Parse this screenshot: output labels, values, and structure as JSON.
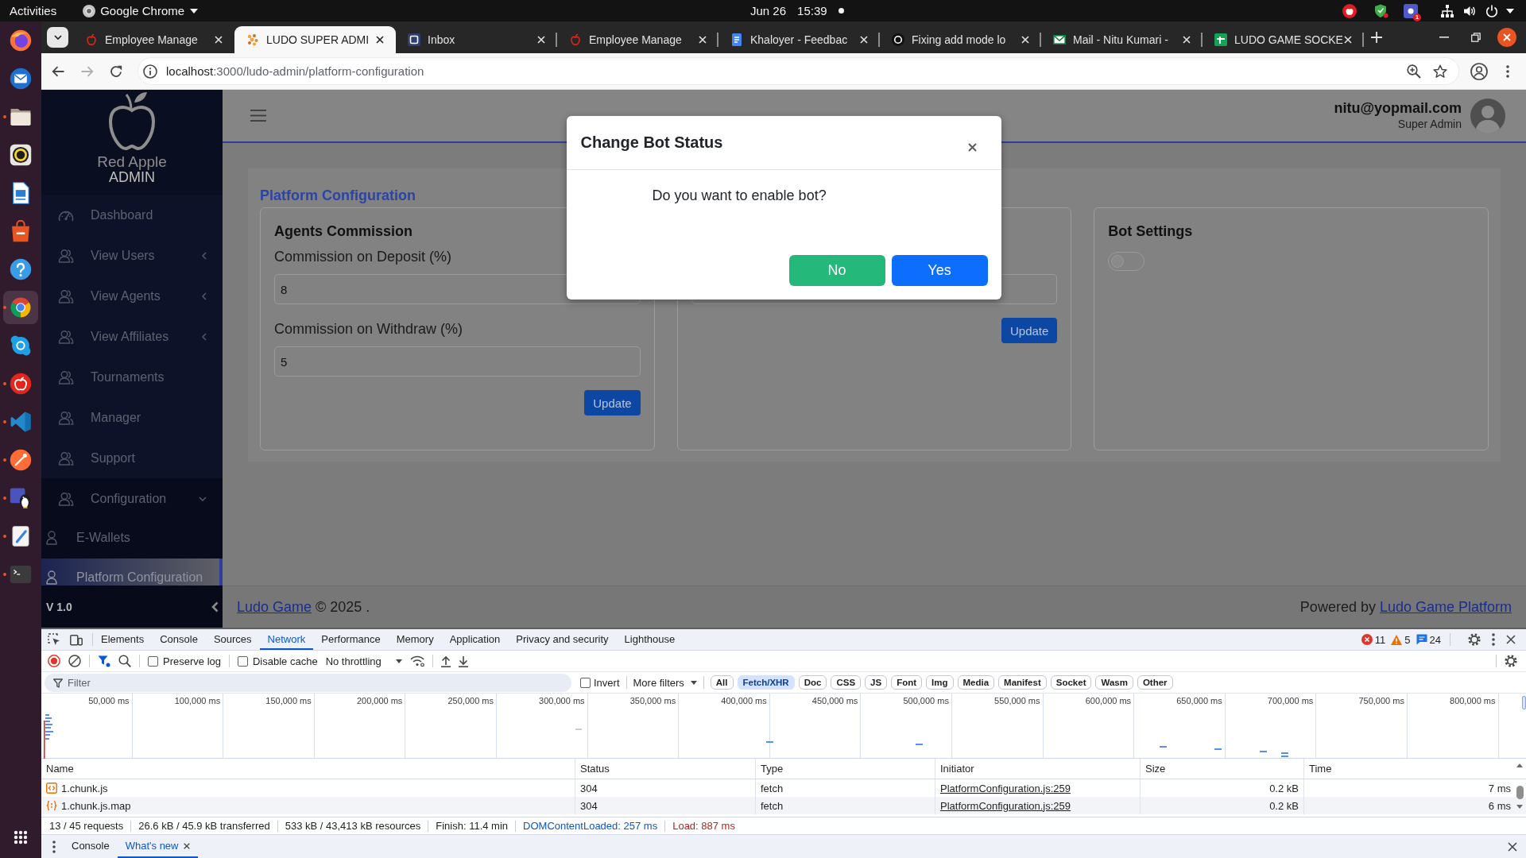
{
  "system_bar": {
    "activities": "Activities",
    "app_name": "Google Chrome",
    "date": "Jun 26",
    "time": "15:39",
    "tray_badge": "1"
  },
  "dock": {
    "items": [
      {
        "kind": "orb",
        "running": false,
        "selected": false
      },
      {
        "kind": "mail",
        "running": false,
        "selected": false
      },
      {
        "kind": "folder",
        "running": true,
        "selected": false
      },
      {
        "kind": "disc",
        "running": false,
        "selected": false
      },
      {
        "kind": "document",
        "running": false,
        "selected": false
      },
      {
        "kind": "store",
        "running": false,
        "selected": false
      },
      {
        "kind": "help",
        "running": false,
        "selected": false
      },
      {
        "kind": "browser",
        "running": true,
        "selected": true
      },
      {
        "kind": "chat",
        "running": false,
        "selected": false
      },
      {
        "kind": "apple",
        "running": true,
        "selected": false
      },
      {
        "kind": "code",
        "running": true,
        "selected": false
      },
      {
        "kind": "pen",
        "running": true,
        "selected": false
      },
      {
        "kind": "team",
        "running": true,
        "selected": false
      },
      {
        "kind": "editor",
        "running": true,
        "selected": false
      },
      {
        "kind": "terminal",
        "running": true,
        "selected": false
      }
    ]
  },
  "browser": {
    "tabs": [
      {
        "kind": "apple",
        "title": "Employee Manage",
        "selected": false
      },
      {
        "kind": "dots",
        "title": "LUDO SUPER ADMI",
        "selected": true
      },
      {
        "kind": "square",
        "title": "Inbox",
        "selected": false
      },
      {
        "kind": "apple",
        "title": "Employee Manage",
        "selected": false
      },
      {
        "kind": "doc",
        "title": "Khaloyer - Feedbac",
        "selected": false
      },
      {
        "kind": "ring",
        "title": "Fixing add mode lo",
        "selected": false
      },
      {
        "kind": "envelope",
        "title": "Mail - Nitu Kumari -",
        "selected": false
      },
      {
        "kind": "sheet",
        "title": "LUDO GAME SOCKE",
        "selected": false
      }
    ],
    "back_disabled": false,
    "forward_disabled": true,
    "url_host": "localhost",
    "url_path": ":3000/ludo-admin/platform-configuration"
  },
  "page": {
    "sidebar": {
      "brand": "Red Apple",
      "brand_subtitle": "ADMIN",
      "items": [
        {
          "kind": "home",
          "label": "Dashboard",
          "selected": false
        },
        {
          "kind": "group",
          "label": "View Users",
          "expanded": false,
          "selected": false
        },
        {
          "kind": "group",
          "label": "View Agents",
          "expanded": false,
          "selected": false
        },
        {
          "kind": "group",
          "label": "View Affiliates",
          "expanded": false,
          "selected": false
        },
        {
          "kind": "link",
          "label": "Tournaments",
          "selected": false
        },
        {
          "kind": "link",
          "label": "Manager",
          "selected": false
        },
        {
          "kind": "link",
          "label": "Support",
          "selected": false
        },
        {
          "kind": "group",
          "label": "Configuration",
          "expanded": true,
          "selected": false,
          "children": [
            {
              "kind": "link",
              "label": "E-Wallets",
              "selected": false
            },
            {
              "kind": "link",
              "label": "Platform Configuration",
              "selected": true
            }
          ]
        }
      ],
      "version": "V 1.0"
    },
    "header": {
      "user_email": "nitu@yopmail.com",
      "user_role": "Super Admin"
    },
    "title": "Platform Configuration",
    "cards": [
      {
        "kind": "form",
        "title": "Agents Commission",
        "fields": [
          {
            "kind": "number",
            "label": "Commission on Deposit (%)",
            "value": "8"
          },
          {
            "kind": "number",
            "label": "Commission on Withdraw (%)",
            "value": "5"
          }
        ],
        "button": "Update"
      },
      {
        "kind": "form",
        "fields": [
          {
            "kind": "number"
          }
        ],
        "button": "Update"
      },
      {
        "kind": "switch",
        "title": "Bot Settings",
        "on": false
      }
    ],
    "footer": {
      "link": "Ludo Game",
      "text": "© 2025 .",
      "credit": "Powered by",
      "credit_link": "Ludo Game Platform"
    }
  },
  "modal": {
    "title": "Change Bot Status",
    "message": "Do you want to enable bot?",
    "buttons": [
      {
        "kind": "cancel",
        "label": "No"
      },
      {
        "kind": "confirm",
        "label": "Yes"
      }
    ]
  },
  "devtools": {
    "panel_tabs": [
      {
        "label": "Elements",
        "selected": false
      },
      {
        "label": "Console",
        "selected": false
      },
      {
        "label": "Sources",
        "selected": false
      },
      {
        "label": "Network",
        "selected": true
      },
      {
        "label": "Performance",
        "selected": false
      },
      {
        "label": "Memory",
        "selected": false
      },
      {
        "label": "Application",
        "selected": false
      },
      {
        "label": "Privacy and security",
        "selected": false
      },
      {
        "label": "Lighthouse",
        "selected": false
      }
    ],
    "issues": {
      "errors": "11",
      "warnings": "5",
      "messages": "24"
    },
    "recording": true,
    "options": [
      {
        "label": "Preserve log",
        "checked": false
      },
      {
        "label": "Disable cache",
        "checked": false
      }
    ],
    "throttling": "No throttling",
    "filter": {
      "placeholder": "Filter",
      "invert": {
        "label": "Invert",
        "checked": false
      },
      "more_filters": "More filters"
    },
    "type_filters": [
      {
        "label": "All",
        "selected": false
      },
      {
        "label": "Fetch/XHR",
        "selected": true
      },
      {
        "label": "Doc",
        "selected": false
      },
      {
        "label": "CSS",
        "selected": false
      },
      {
        "label": "JS",
        "selected": false
      },
      {
        "label": "Font",
        "selected": false
      },
      {
        "label": "Img",
        "selected": false
      },
      {
        "label": "Media",
        "selected": false
      },
      {
        "label": "Manifest",
        "selected": false
      },
      {
        "label": "Socket",
        "selected": false
      },
      {
        "label": "Wasm",
        "selected": false
      },
      {
        "label": "Other",
        "selected": false
      }
    ],
    "timeline_ticks": [
      "50,000 ms",
      "100,000 ms",
      "150,000 ms",
      "200,000 ms",
      "250,000 ms",
      "300,000 ms",
      "350,000 ms",
      "400,000 ms",
      "450,000 ms",
      "500,000 ms",
      "550,000 ms",
      "600,000 ms",
      "650,000 ms",
      "700,000 ms",
      "750,000 ms",
      "800,000 ms"
    ],
    "columns": [
      "Name",
      "Status",
      "Type",
      "Initiator",
      "Size",
      "Time"
    ],
    "rows": [
      {
        "kind": "script",
        "name": "1.chunk.js",
        "status": "304",
        "type": "fetch",
        "initiator": "PlatformConfiguration.js:259",
        "size": "0.2 kB",
        "time": "7 ms"
      },
      {
        "kind": "map",
        "name": "1.chunk.js.map",
        "status": "304",
        "type": "fetch",
        "initiator": "PlatformConfiguration.js:259",
        "size": "0.2 kB",
        "time": "6 ms"
      }
    ],
    "summary": [
      {
        "kind": "plain",
        "text": "13 / 45 requests"
      },
      {
        "kind": "plain",
        "text": "26.6 kB / 45.9 kB transferred"
      },
      {
        "kind": "plain",
        "text": "533 kB / 43,413 kB resources"
      },
      {
        "kind": "plain",
        "text": "Finish: 11.4 min"
      },
      {
        "kind": "dom",
        "text": "DOMContentLoaded: 257 ms"
      },
      {
        "kind": "load",
        "text": "Load: 887 ms"
      }
    ],
    "drawer_tabs": [
      {
        "label": "Console",
        "selected": false,
        "closable": false
      },
      {
        "label": "What's new",
        "selected": true,
        "closable": true
      }
    ]
  }
}
